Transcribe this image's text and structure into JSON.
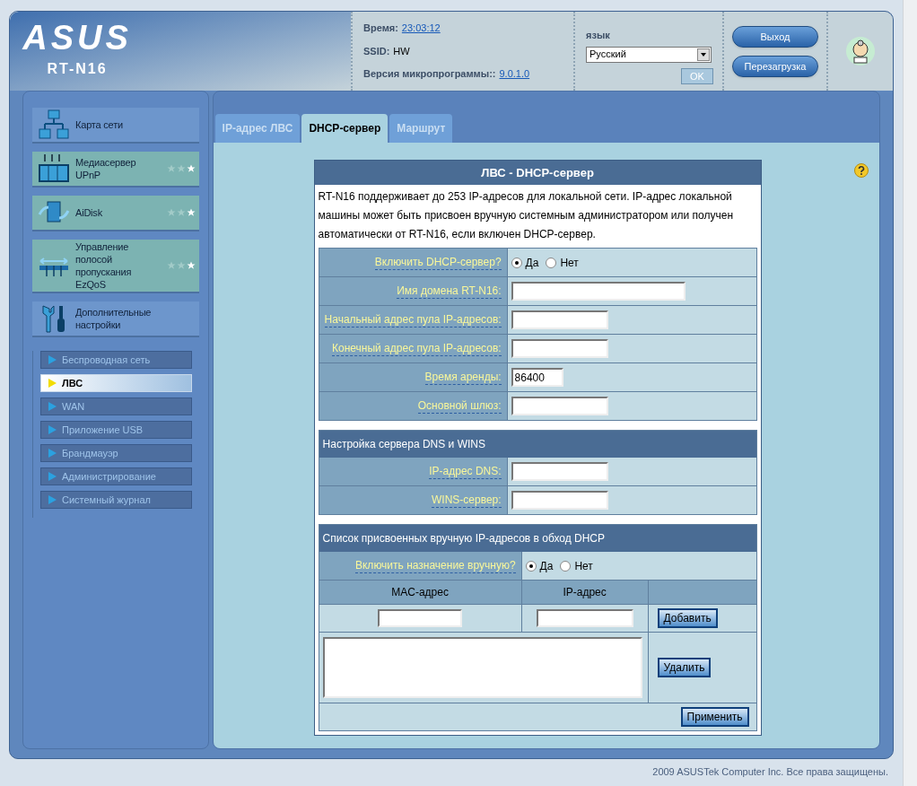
{
  "header": {
    "logo": "ASUS",
    "model": "RT-N16",
    "info": [
      {
        "label": "Время:",
        "value": "23:03:12",
        "kind": "link"
      },
      {
        "label": "SSID:",
        "value": "HW",
        "kind": "text"
      },
      {
        "label": "Версия микропрограммы::",
        "value": "9.0.1.0",
        "kind": "link"
      }
    ],
    "language": {
      "label": "язык",
      "value": "Русский",
      "ok": "OK"
    },
    "buttons": [
      "Выход",
      "Перезагрузка"
    ]
  },
  "sidebar": {
    "menu": [
      {
        "label": "Карта сети",
        "kind": "network"
      },
      {
        "label": "Медиасервер UPnP",
        "kind": "media",
        "stars": 1
      },
      {
        "label": "AiDisk",
        "kind": "disk",
        "stars": 1
      },
      {
        "label": "Управление полосой пропускания EzQoS",
        "kind": "qos",
        "stars": 1
      },
      {
        "label": "Дополнительные настройки",
        "kind": "tools"
      }
    ],
    "submenu": [
      {
        "label": "Беспроводная сеть",
        "selected": false
      },
      {
        "label": "ЛВС",
        "selected": true
      },
      {
        "label": "WAN",
        "selected": false
      },
      {
        "label": "Приложение USB",
        "selected": false
      },
      {
        "label": "Брандмауэр",
        "selected": false
      },
      {
        "label": "Администрирование",
        "selected": false
      },
      {
        "label": "Системный журнал",
        "selected": false
      }
    ]
  },
  "tabs": [
    {
      "label": "IP-адрес ЛВС",
      "selected": false
    },
    {
      "label": "DHCP-сервер",
      "selected": true
    },
    {
      "label": "Маршрут",
      "selected": false
    }
  ],
  "form": {
    "title": "ЛВС - DHCP-сервер",
    "description": "RT-N16 поддерживает до 253 IP-адресов для локальной сети. IP-адрес локальной машины может быть присвоен вручную системным администратором или получен автоматически от RT-N16, если включен DHCP-сервер.",
    "rows": [
      {
        "label": "Включить DHCP-сервер?",
        "kind": "radio",
        "options": [
          {
            "label": "Да",
            "selected": true
          },
          {
            "label": "Нет",
            "selected": false
          }
        ]
      },
      {
        "label": "Имя домена RT-N16:",
        "kind": "input"
      },
      {
        "label": "Начальный адрес пула IP-адресов:",
        "kind": "input"
      },
      {
        "label": "Конечный адрес пула IP-адресов:",
        "kind": "input"
      },
      {
        "label": "Время аренды:",
        "kind": "input",
        "value": "86400"
      },
      {
        "label": "Основной шлюз:",
        "kind": "input"
      }
    ],
    "dns": {
      "title": "Настройка сервера DNS и WINS",
      "rows": [
        {
          "label": "IP-адрес DNS:",
          "kind": "input"
        },
        {
          "label": "WINS-сервер:",
          "kind": "input"
        }
      ]
    },
    "manual": {
      "title": "Список присвоенных вручную IP-адресов в обход DHCP",
      "toggle": {
        "label": "Включить назначение вручную?",
        "kind": "radio",
        "options": [
          {
            "label": "Да",
            "selected": true
          },
          {
            "label": "Нет",
            "selected": false
          }
        ]
      },
      "columns": [
        "MAC-адрес",
        "IP-адрес"
      ],
      "add_button": "Добавить",
      "delete_button": "Удалить",
      "apply_button": "Применить"
    }
  },
  "footer": "2009 ASUSTek Computer Inc. Все права защищены."
}
